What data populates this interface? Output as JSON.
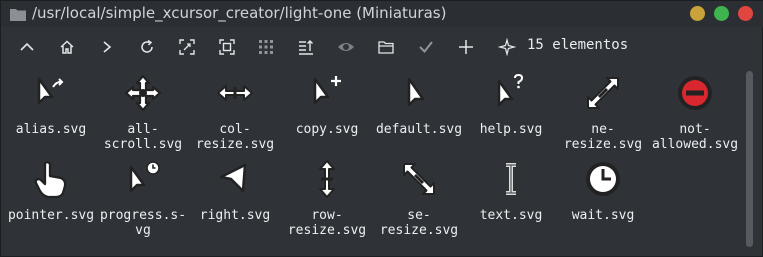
{
  "window": {
    "title": "/usr/local/simple_xcursor_creator/light-one (Miniaturas)"
  },
  "toolbar": {
    "buttons": [
      {
        "name": "up-icon"
      },
      {
        "name": "home-icon"
      },
      {
        "name": "forward-icon"
      },
      {
        "name": "reload-icon"
      },
      {
        "name": "zoom-fit-icon"
      },
      {
        "name": "select-icon"
      },
      {
        "name": "grid-view-icon"
      },
      {
        "name": "sort-icon"
      },
      {
        "name": "show-hidden-icon"
      },
      {
        "name": "folder-icon"
      },
      {
        "name": "check-icon"
      },
      {
        "name": "add-icon"
      },
      {
        "name": "preferences-icon"
      }
    ],
    "count_text": "15 elementos"
  },
  "files": [
    {
      "label": "alias.svg",
      "icon": "alias-cursor-icon"
    },
    {
      "label": "all-\nscroll.svg",
      "icon": "all-scroll-cursor-icon"
    },
    {
      "label": "col-\nresize.svg",
      "icon": "col-resize-cursor-icon"
    },
    {
      "label": "copy.svg",
      "icon": "copy-cursor-icon"
    },
    {
      "label": "default.svg",
      "icon": "default-cursor-icon"
    },
    {
      "label": "help.svg",
      "icon": "help-cursor-icon"
    },
    {
      "label": "ne-\nresize.svg",
      "icon": "ne-resize-cursor-icon"
    },
    {
      "label": "not-\nallowed.svg",
      "icon": "not-allowed-cursor-icon"
    },
    {
      "label": "pointer.svg",
      "icon": "pointer-cursor-icon"
    },
    {
      "label": "progress.s-\nvg",
      "icon": "progress-cursor-icon"
    },
    {
      "label": "right.svg",
      "icon": "right-cursor-icon"
    },
    {
      "label": "row-\nresize.svg",
      "icon": "row-resize-cursor-icon"
    },
    {
      "label": "se-\nresize.svg",
      "icon": "se-resize-cursor-icon"
    },
    {
      "label": "text.svg",
      "icon": "text-cursor-icon"
    },
    {
      "label": "wait.svg",
      "icon": "wait-cursor-icon"
    }
  ],
  "colors": {
    "background": "#2f3338",
    "titlebar": "#2b2f33",
    "minimize": "#c9a23a",
    "maximize": "#3fb34f",
    "close": "#e0453f",
    "forbidden_red": "#d8272e"
  }
}
